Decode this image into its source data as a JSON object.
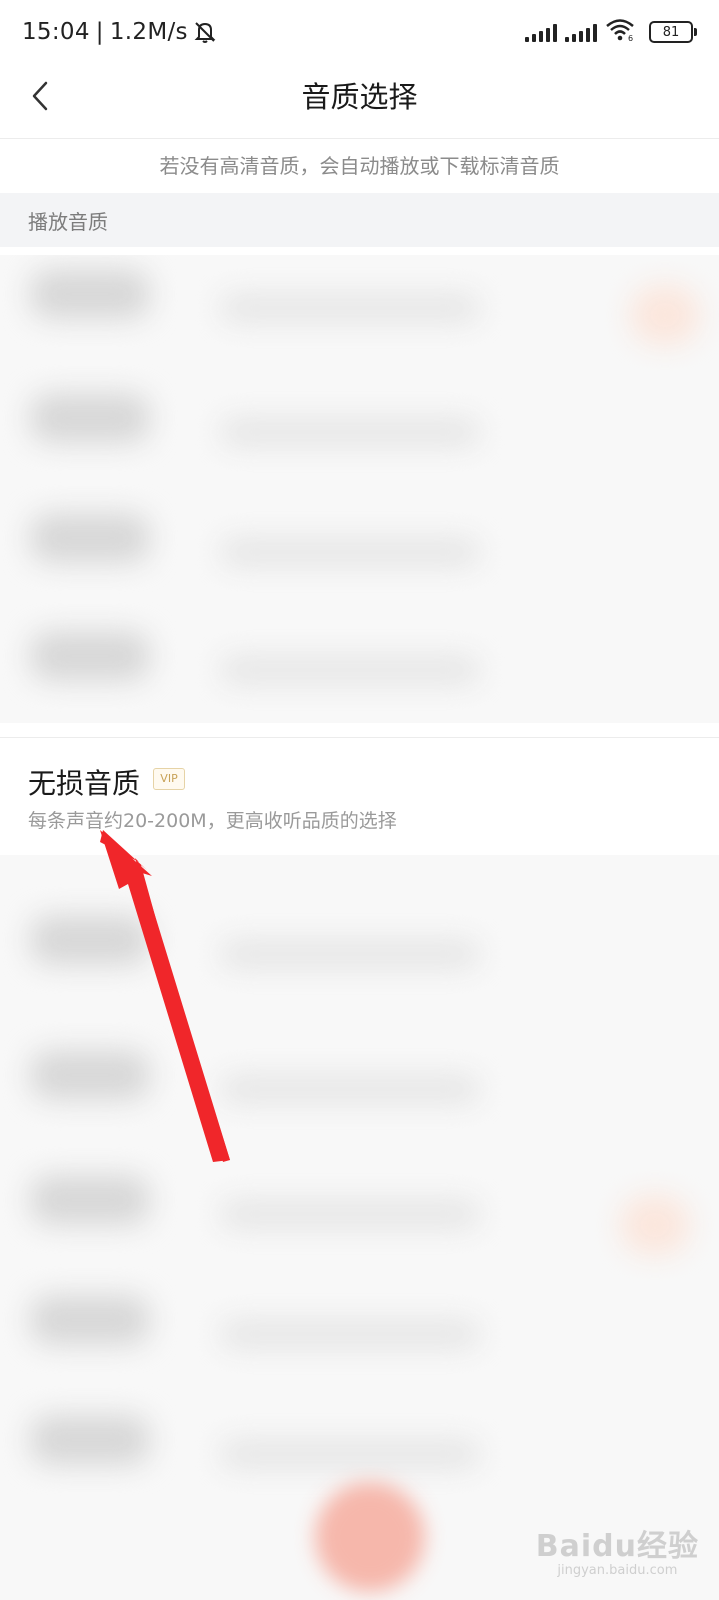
{
  "status_bar": {
    "time": "15:04",
    "separator": "|",
    "speed": "1.2M/s",
    "battery": "81",
    "icons": [
      "mute-bell-icon",
      "signal-icon",
      "signal-icon",
      "wifi-icon",
      "battery-icon"
    ]
  },
  "header": {
    "title": "音质选择",
    "back_icon": "back-chevron-icon"
  },
  "notice": "若没有高清音质，会自动播放或下载标清音质",
  "section": {
    "label": "播放音质"
  },
  "option": {
    "title": "无损音质",
    "badge": "VIP",
    "desc": "每条声音约20-200M，更高收听品质的选择"
  },
  "watermark": {
    "logo": "Baidu经验",
    "url": "jingyan.baidu.com"
  },
  "colors": {
    "vip_gold": "#c8a257",
    "annotation_arrow": "#f0262a",
    "section_bg": "#f3f4f6"
  }
}
